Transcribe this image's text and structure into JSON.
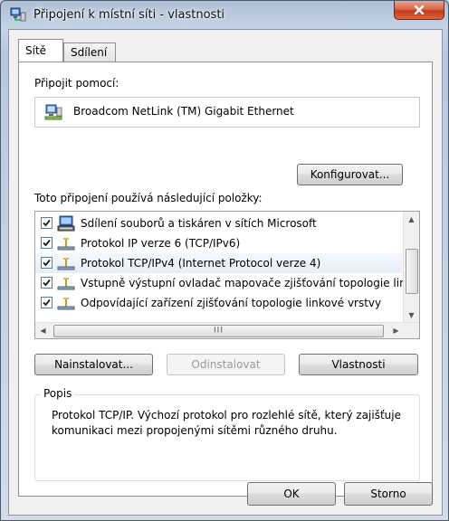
{
  "window": {
    "title": "Připojení k místní síti - vlastnosti",
    "close_label": "✕"
  },
  "tabs": [
    {
      "label": "Sítě",
      "active": true
    },
    {
      "label": "Sdílení",
      "active": false
    }
  ],
  "connect_using": {
    "label": "Připojit pomocí:",
    "adapter": "Broadcom NetLink (TM) Gigabit Ethernet",
    "configure_label": "Konfigurovat..."
  },
  "items_section": {
    "label": "Toto připojení používá následující položky:",
    "items": [
      {
        "label": "Sdílení souborů a tiskáren v sítích Microsoft",
        "checked": true,
        "icon": "network-sharing-icon"
      },
      {
        "label": "Protokol IP verze 6 (TCP/IPv6)",
        "checked": true,
        "icon": "network-protocol-icon"
      },
      {
        "label": "Protokol TCP/IPv4 (Internet Protocol verze 4)",
        "checked": true,
        "icon": "network-protocol-icon",
        "selected": true
      },
      {
        "label": "Vstupně výstupní ovladač mapovače zjišťování topologie linkové vrstvy",
        "checked": true,
        "icon": "network-protocol-icon"
      },
      {
        "label": "Odpovídající zařízení zjišťování topologie linkové vrstvy",
        "checked": true,
        "icon": "network-protocol-icon"
      }
    ],
    "hscroll_grip": "III"
  },
  "actions": {
    "install_label": "Nainstalovat...",
    "uninstall_label": "Odinstalovat",
    "properties_label": "Vlastnosti"
  },
  "description": {
    "title": "Popis",
    "text": "Protokol TCP/IP. Výchozí protokol pro rozlehlé sítě, který zajišťuje komunikaci mezi propojenými sítěmi různého druhu."
  },
  "footer": {
    "ok_label": "OK",
    "cancel_label": "Storno"
  },
  "colors": {
    "close_red": "#c43a1c",
    "selection": "#e6eef8"
  }
}
